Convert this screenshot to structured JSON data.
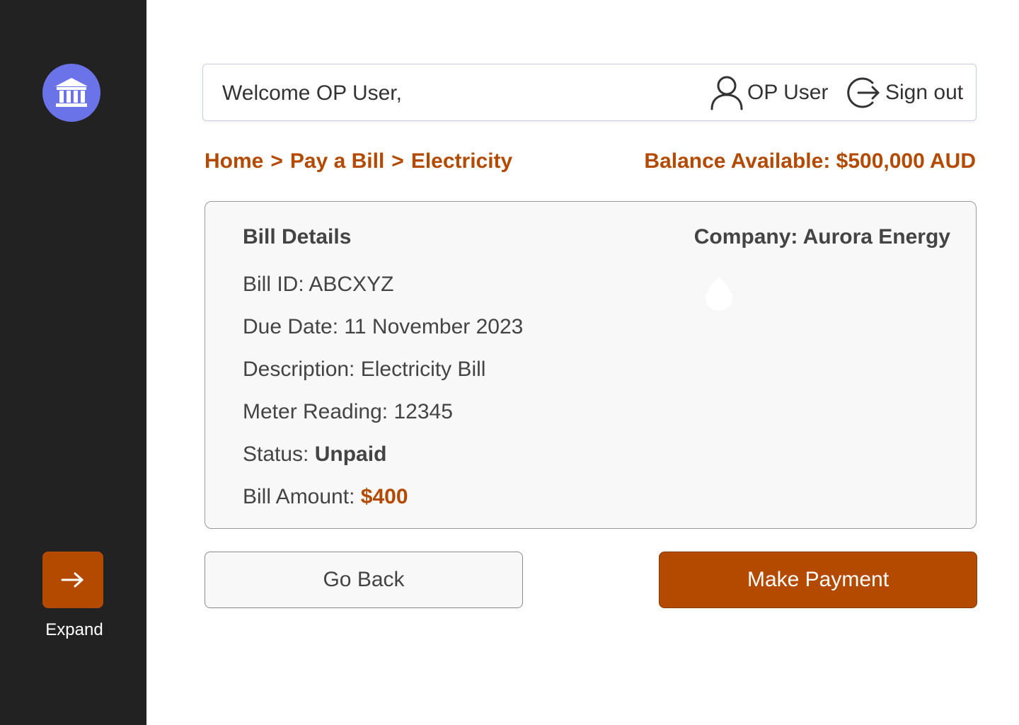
{
  "sidebar": {
    "logo_icon": "bank-icon",
    "expand_icon": "arrow-right-icon",
    "expand_label": "Expand"
  },
  "header": {
    "welcome": "Welcome OP User,",
    "user_icon": "user-icon",
    "user_name": "OP User",
    "signout_icon": "sign-out-icon",
    "signout_label": "Sign out"
  },
  "breadcrumb": {
    "items": [
      "Home",
      "Pay a Bill",
      "Electricity"
    ],
    "separator": ">"
  },
  "balance": "Balance Available: $500,000 AUD",
  "bill": {
    "title": "Bill Details",
    "company": "Company: Aurora Energy",
    "id_label": "Bill ID:",
    "id_value": "ABCXYZ",
    "due_label": "Due Date:",
    "due_value": "11 November 2023",
    "desc_label": "Description:",
    "desc_value": "Electricity Bill",
    "meter_label": "Meter Reading:",
    "meter_value": "12345",
    "status_label": "Status:",
    "status_value": "Unpaid",
    "amount_label": "Bill Amount:",
    "amount_value": "$400",
    "company_logo_icon": "droplet-icon"
  },
  "actions": {
    "back_label": "Go Back",
    "pay_label": "Make Payment"
  },
  "colors": {
    "accent": "#b34a00",
    "sidebar": "#222222",
    "logo": "#6b73e8"
  }
}
